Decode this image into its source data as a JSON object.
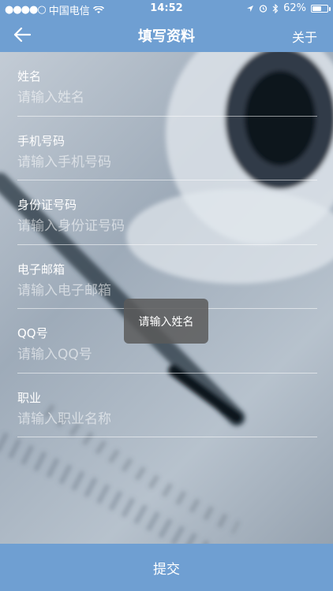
{
  "status_bar": {
    "signal_dots": "●●●●○",
    "carrier": "中国电信",
    "time": "14:52",
    "battery_percent": "62%",
    "battery_level": 0.62
  },
  "nav": {
    "title": "填写资料",
    "about_label": "关于"
  },
  "form": {
    "fields": [
      {
        "label": "姓名",
        "placeholder": "请输入姓名"
      },
      {
        "label": "手机号码",
        "placeholder": "请输入手机号码"
      },
      {
        "label": "身份证号码",
        "placeholder": "请输入身份证号码"
      },
      {
        "label": "电子邮箱",
        "placeholder": "请输入电子邮箱"
      },
      {
        "label": "QQ号",
        "placeholder": "请输入QQ号"
      },
      {
        "label": "职业",
        "placeholder": "请输入职业名称"
      }
    ]
  },
  "toast": {
    "message": "请输入姓名"
  },
  "submit": {
    "label": "提交"
  },
  "colors": {
    "accent": "#6f9fd2"
  }
}
